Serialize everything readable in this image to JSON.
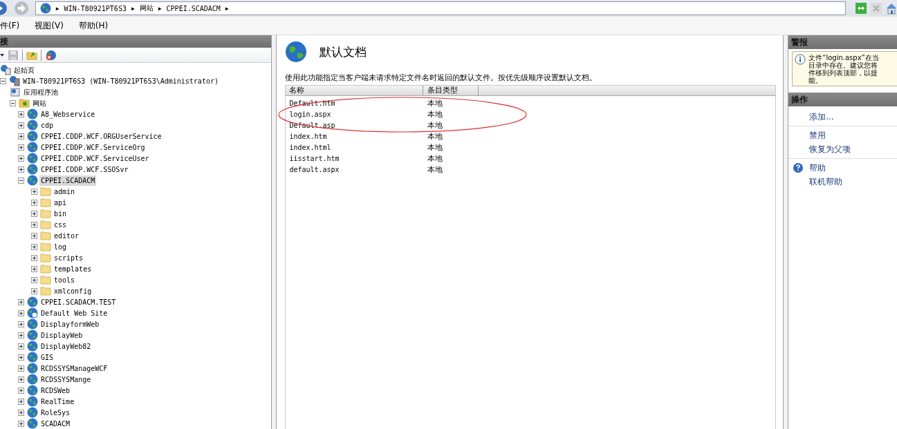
{
  "address_bar": {
    "crumbs": [
      "WIN-T80921PT6S3",
      "网站",
      "CPPEI.SCADACM"
    ],
    "separator": "▶"
  },
  "menu": [
    "件(F)",
    "视图(V)",
    "帮助(H)"
  ],
  "connections": {
    "title": "接",
    "tree": [
      {
        "label": "起始页",
        "kind": "start",
        "selected": false
      },
      {
        "label": "WIN-T80921PT6S3 (WIN-T80921PT6S3\\Administrator)",
        "kind": "server",
        "expanded": true,
        "selected": false,
        "children": [
          {
            "label": "应用程序池",
            "kind": "pool",
            "selected": false
          },
          {
            "label": "网站",
            "kind": "sites",
            "expanded": true,
            "selected": false,
            "children": [
              {
                "label": "A8_Webservice",
                "kind": "site",
                "expanded": false,
                "selected": false
              },
              {
                "label": "cdp",
                "kind": "site",
                "expanded": false,
                "selected": false
              },
              {
                "label": "CPPEI.CDDP.WCF.ORGUserService",
                "kind": "site",
                "expanded": false,
                "selected": false
              },
              {
                "label": "CPPEI.CDDP.WCF.ServiceOrg",
                "kind": "site",
                "expanded": false,
                "selected": false
              },
              {
                "label": "CPPEI.CDDP.WCF.ServiceUser",
                "kind": "site",
                "expanded": false,
                "selected": false
              },
              {
                "label": "CPPEI.CDDP.WCF.SSOSvr",
                "kind": "site",
                "expanded": false,
                "selected": false
              },
              {
                "label": "CPPEI.SCADACM",
                "kind": "site",
                "expanded": true,
                "selected": true,
                "children": [
                  {
                    "label": "admin",
                    "kind": "folder",
                    "expanded": false,
                    "selected": false
                  },
                  {
                    "label": "api",
                    "kind": "folder",
                    "expanded": false,
                    "selected": false
                  },
                  {
                    "label": "bin",
                    "kind": "folder",
                    "expanded": false,
                    "selected": false
                  },
                  {
                    "label": "css",
                    "kind": "folder",
                    "expanded": false,
                    "selected": false
                  },
                  {
                    "label": "editor",
                    "kind": "folder",
                    "expanded": false,
                    "selected": false
                  },
                  {
                    "label": "log",
                    "kind": "folder",
                    "expanded": false,
                    "selected": false
                  },
                  {
                    "label": "scripts",
                    "kind": "folder",
                    "expanded": false,
                    "selected": false
                  },
                  {
                    "label": "templates",
                    "kind": "folder",
                    "expanded": false,
                    "selected": false
                  },
                  {
                    "label": "tools",
                    "kind": "folder",
                    "expanded": false,
                    "selected": false
                  },
                  {
                    "label": "xmlconfig",
                    "kind": "folder",
                    "expanded": false,
                    "selected": false
                  }
                ]
              },
              {
                "label": "CPPEI.SCADACM.TEST",
                "kind": "site",
                "expanded": false,
                "selected": false
              },
              {
                "label": "Default Web Site",
                "kind": "default-site",
                "expanded": false,
                "selected": false
              },
              {
                "label": "DisplayformWeb",
                "kind": "site",
                "expanded": false,
                "selected": false
              },
              {
                "label": "DisplayWeb",
                "kind": "site",
                "expanded": false,
                "selected": false
              },
              {
                "label": "DisplayWeb82",
                "kind": "site",
                "expanded": false,
                "selected": false
              },
              {
                "label": "GIS",
                "kind": "site",
                "expanded": false,
                "selected": false
              },
              {
                "label": "RCDSSYSManageWCF",
                "kind": "site",
                "expanded": false,
                "selected": false
              },
              {
                "label": "RCDSSYSMange",
                "kind": "site",
                "expanded": false,
                "selected": false
              },
              {
                "label": "RCDSWeb",
                "kind": "site",
                "expanded": false,
                "selected": false
              },
              {
                "label": "RealTime",
                "kind": "site",
                "expanded": false,
                "selected": false
              },
              {
                "label": "RoleSys",
                "kind": "site",
                "expanded": false,
                "selected": false
              },
              {
                "label": "SCADACM",
                "kind": "site",
                "expanded": false,
                "selected": false
              }
            ]
          }
        ]
      }
    ]
  },
  "feature": {
    "title": "默认文档",
    "description": "使用此功能指定当客户端未请求特定文件名时返回的默认文件。按优先级顺序设置默认文档。",
    "columns": [
      "名称",
      "条目类型"
    ],
    "rows": [
      {
        "name": "Default.htm",
        "type": "本地"
      },
      {
        "name": "login.aspx",
        "type": "本地"
      },
      {
        "name": "Default.asp",
        "type": "本地"
      },
      {
        "name": "index.htm",
        "type": "本地"
      },
      {
        "name": "index.html",
        "type": "本地"
      },
      {
        "name": "iisstart.htm",
        "type": "本地"
      },
      {
        "name": "default.aspx",
        "type": "本地"
      }
    ]
  },
  "alerts": {
    "title": "警报",
    "lines": [
      "文件“login.aspx”在当",
      "目录中存在。建议您将",
      "件移到列表顶部，以提",
      "能。"
    ]
  },
  "actions": {
    "title": "操作",
    "groups": [
      [
        {
          "label": "添加...",
          "kind": "plain"
        }
      ],
      [
        {
          "label": "禁用",
          "kind": "plain"
        },
        {
          "label": "恢复为父项",
          "kind": "plain"
        }
      ],
      [
        {
          "label": "帮助",
          "kind": "help"
        },
        {
          "label": "联机帮助",
          "kind": "plain"
        }
      ]
    ]
  }
}
